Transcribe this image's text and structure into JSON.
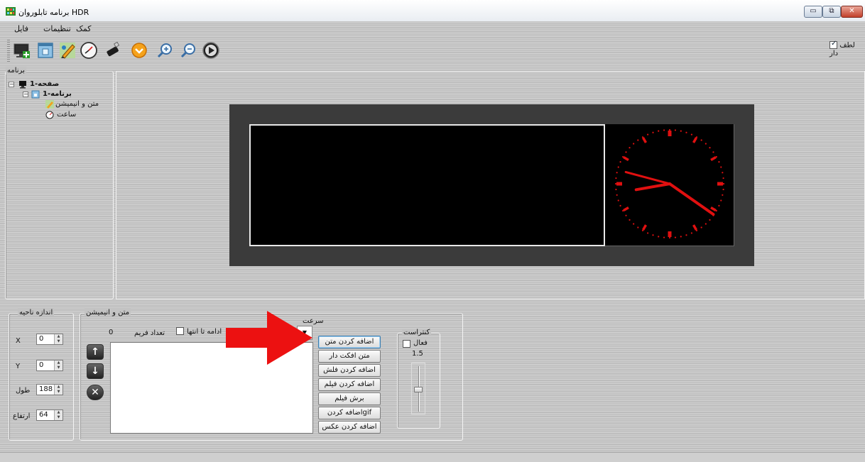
{
  "window": {
    "title": "برنامه تابلوروان HDR",
    "min_glyph": "▭",
    "max_glyph": "⧉",
    "close_glyph": "✕"
  },
  "menu": {
    "items": [
      "فایل",
      "تنظیمات",
      "کمک"
    ]
  },
  "toolbar": {
    "icons": [
      "monitor-add-icon",
      "window-icon",
      "pencil-brush-icon",
      "clock-icon",
      "usb-drive-icon",
      "orange-download-icon",
      "zoom-in-icon",
      "zoom-out-icon",
      "play-icon"
    ],
    "antialias_label": "لطف دار",
    "antialias_checked": true
  },
  "tree": {
    "group_label": "برنامه",
    "nodes": [
      {
        "label": "صفحه-1",
        "icon": "monitor-icon"
      },
      {
        "label": "برنامه-1",
        "icon": "window-icon"
      },
      {
        "label": "متن و انیمیشن",
        "icon": "pencil-icon"
      },
      {
        "label": "ساعت",
        "icon": "clock-icon"
      }
    ]
  },
  "region": {
    "group_label": "اندازه ناحیه",
    "x_label": "X",
    "x_value": "0",
    "y_label": "Y",
    "y_value": "0",
    "width_label": "طول",
    "width_value": "188",
    "height_label": "ارتفاع",
    "height_value": "64"
  },
  "text_anim": {
    "group_label": "متن و انیمیشن",
    "frame_count_label": "تعداد فریم",
    "frame_count_value": "0",
    "continue_label": "ادامه تا انتها",
    "speed_label": "سرعت",
    "buttons": {
      "add_text": "اضافه کردن متن",
      "effect_text": "متن افکت دار",
      "add_flash": "اضافه کردن فلش",
      "add_movie": "اضافه کردن فیلم",
      "cut_movie": "برش فیلم",
      "add_gif": "اضافه کردنgif",
      "add_image": "اضافه کردن عکس"
    }
  },
  "contrast": {
    "group_label": "کنتراست",
    "active_label": "فعال",
    "value": "1.5",
    "slider_level": 0.5
  },
  "colors": {
    "led_red": "#e01010",
    "arrow_red": "#ec1111",
    "led_frame": "#3b3b3b"
  }
}
